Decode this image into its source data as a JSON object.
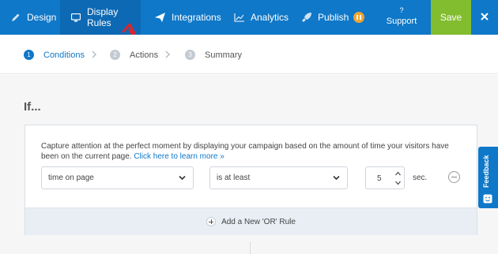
{
  "topbar": {
    "tabs": [
      {
        "label": "Design",
        "icon": "pencil-icon",
        "active": false
      },
      {
        "label": "Display Rules",
        "icon": "monitor-icon",
        "active": true
      },
      {
        "label": "Integrations",
        "icon": "paper-plane-icon",
        "active": false
      },
      {
        "label": "Analytics",
        "icon": "chart-icon",
        "active": false
      },
      {
        "label": "Publish",
        "icon": "rocket-icon",
        "active": false
      }
    ],
    "support": {
      "glyph": "?",
      "label": "Support"
    },
    "save_label": "Save",
    "close_icon": "close-icon",
    "colors": {
      "bar": "#0f78c8",
      "active_tab": "#0d69b3",
      "save": "#82bd2f",
      "publish_badge": "#f0a530"
    }
  },
  "steps": [
    {
      "number": "1",
      "label": "Conditions",
      "active": true
    },
    {
      "number": "2",
      "label": "Actions",
      "active": false
    },
    {
      "number": "3",
      "label": "Summary",
      "active": false
    }
  ],
  "main": {
    "heading": "If...",
    "description": "Capture attention at the perfect moment by displaying your campaign based on the amount of time your visitors have been on the current page.",
    "learn_more": "Click here to learn more »",
    "rule": {
      "condition": "time on page",
      "operator": "is at least",
      "value": "5",
      "unit": "sec."
    },
    "add_or_rule": "Add a New 'OR' Rule"
  },
  "feedback": {
    "label": "Feedback"
  }
}
